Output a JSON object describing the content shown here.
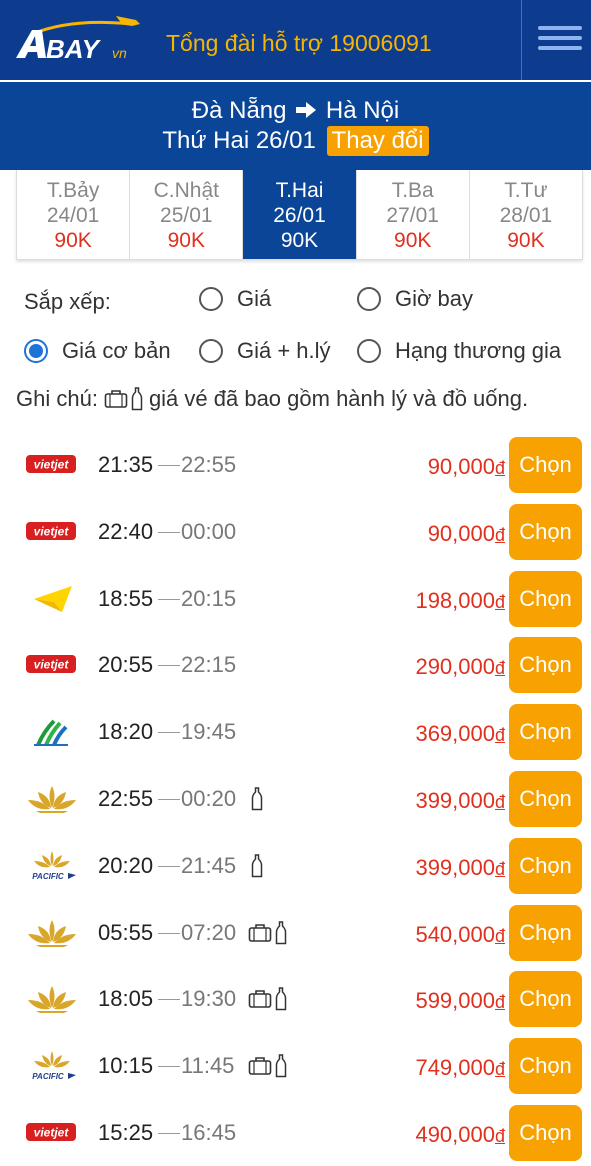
{
  "header": {
    "logo_text": "BAY",
    "logo_suffix": "vn",
    "hotline": "Tổng đài hỗ trợ 19006091"
  },
  "route": {
    "from": "Đà Nẵng",
    "to": "Hà Nội",
    "date": "Thứ Hai 26/01",
    "change_label": "Thay đổi"
  },
  "date_tabs": [
    {
      "day": "T.Bảy",
      "date": "24/01",
      "price": "90K",
      "active": false
    },
    {
      "day": "C.Nhật",
      "date": "25/01",
      "price": "90K",
      "active": false
    },
    {
      "day": "T.Hai",
      "date": "26/01",
      "price": "90K",
      "active": true
    },
    {
      "day": "T.Ba",
      "date": "27/01",
      "price": "90K",
      "active": false
    },
    {
      "day": "T.Tư",
      "date": "28/01",
      "price": "90K",
      "active": false
    }
  ],
  "sort": {
    "label": "Sắp xếp:",
    "options": [
      {
        "label": "Giá",
        "checked": false
      },
      {
        "label": "Giờ bay",
        "checked": false
      },
      {
        "label": "Giá cơ bản",
        "checked": true
      },
      {
        "label": "Giá + h.lý",
        "checked": false
      },
      {
        "label": "Hạng thương gia",
        "checked": false
      }
    ]
  },
  "note": {
    "prefix": "Ghi chú:",
    "text": "giá vé đã bao gồm hành lý và đồ uống."
  },
  "choose_label": "Chọn",
  "currency_symbol": "đ",
  "flights": [
    {
      "airline": "vietjet",
      "dep": "21:35",
      "arr": "22:55",
      "price": "90,000",
      "extras": []
    },
    {
      "airline": "vietjet",
      "dep": "22:40",
      "arr": "00:00",
      "price": "90,000",
      "extras": []
    },
    {
      "airline": "vietravel",
      "dep": "18:55",
      "arr": "20:15",
      "price": "198,000",
      "extras": []
    },
    {
      "airline": "vietjet",
      "dep": "20:55",
      "arr": "22:15",
      "price": "290,000",
      "extras": []
    },
    {
      "airline": "bamboo",
      "dep": "18:20",
      "arr": "19:45",
      "price": "369,000",
      "extras": []
    },
    {
      "airline": "vietnam-airlines",
      "dep": "22:55",
      "arr": "00:20",
      "price": "399,000",
      "extras": [
        "bottle"
      ]
    },
    {
      "airline": "pacific",
      "dep": "20:20",
      "arr": "21:45",
      "price": "399,000",
      "extras": [
        "bottle"
      ]
    },
    {
      "airline": "vietnam-airlines",
      "dep": "05:55",
      "arr": "07:20",
      "price": "540,000",
      "extras": [
        "luggage",
        "bottle"
      ]
    },
    {
      "airline": "vietnam-airlines",
      "dep": "18:05",
      "arr": "19:30",
      "price": "599,000",
      "extras": [
        "luggage",
        "bottle"
      ]
    },
    {
      "airline": "pacific",
      "dep": "10:15",
      "arr": "11:45",
      "price": "749,000",
      "extras": [
        "luggage",
        "bottle"
      ]
    },
    {
      "airline": "vietjet",
      "dep": "15:25",
      "arr": "16:45",
      "price": "490,000",
      "extras": []
    }
  ],
  "airline_logo_text": {
    "vietjet": "vietjet",
    "pacific": "PACIFIC"
  },
  "colors": {
    "header_bg": "#0d3c8e",
    "panel_bg": "#0b4597",
    "accent": "#f7a200",
    "price": "#e0301e",
    "radio_checked": "#1e73d8"
  }
}
